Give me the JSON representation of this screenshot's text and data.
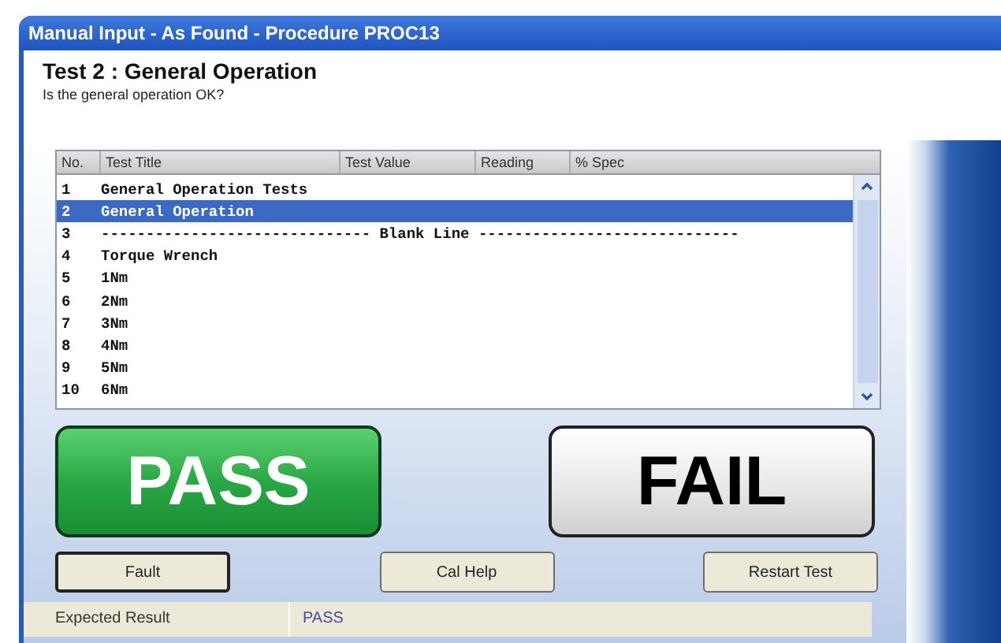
{
  "window": {
    "title": "Manual Input - As Found - Procedure PROC13"
  },
  "test": {
    "heading": "Test 2 : General Operation",
    "question": "Is the general operation OK?"
  },
  "table": {
    "columns": [
      "No.",
      "Test Title",
      "Test Value",
      "Reading",
      "% Spec"
    ],
    "rows": [
      {
        "no": "1",
        "title": "General Operation Tests",
        "selected": false
      },
      {
        "no": "2",
        "title": "General Operation",
        "selected": true
      },
      {
        "no": "3",
        "title": "------------------------------ Blank Line -----------------------------",
        "selected": false
      },
      {
        "no": "4",
        "title": "Torque Wrench",
        "selected": false
      },
      {
        "no": "5",
        "title": "1Nm",
        "selected": false
      },
      {
        "no": "6",
        "title": "2Nm",
        "selected": false
      },
      {
        "no": "7",
        "title": "3Nm",
        "selected": false
      },
      {
        "no": "8",
        "title": "4Nm",
        "selected": false
      },
      {
        "no": "9",
        "title": "5Nm",
        "selected": false
      },
      {
        "no": "10",
        "title": "6Nm",
        "selected": false
      }
    ]
  },
  "result_buttons": [
    {
      "label": "PASS",
      "kind": "pass"
    },
    {
      "label": "FAIL",
      "kind": "fail"
    }
  ],
  "buttons": [
    {
      "label": "Fault",
      "focused": true
    },
    {
      "label": "Cal Help",
      "focused": false
    },
    {
      "label": "Restart Test",
      "focused": false
    }
  ],
  "status_bar": {
    "label": "Expected Result",
    "value": "PASS"
  }
}
